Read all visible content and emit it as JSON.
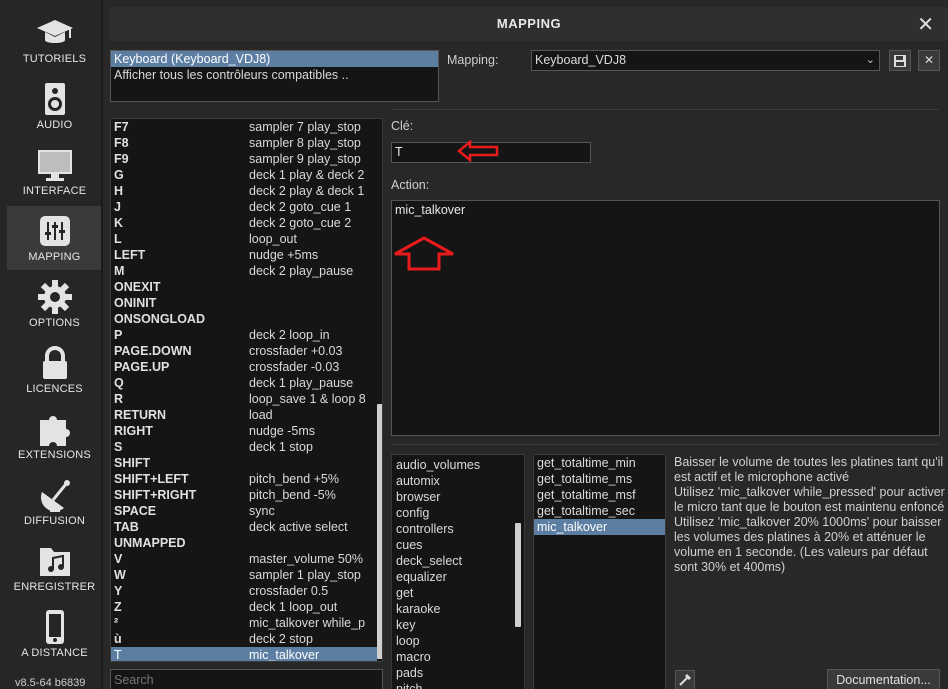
{
  "sidebar": {
    "items": [
      {
        "label": "TUTORIELS",
        "icon": "graduation-cap-icon"
      },
      {
        "label": "AUDIO",
        "icon": "speaker-icon"
      },
      {
        "label": "INTERFACE",
        "icon": "monitor-icon"
      },
      {
        "label": "MAPPING",
        "icon": "mixer-sliders-icon",
        "active": true
      },
      {
        "label": "OPTIONS",
        "icon": "gear-icon"
      },
      {
        "label": "LICENCES",
        "icon": "lock-icon"
      },
      {
        "label": "EXTENSIONS",
        "icon": "puzzle-icon"
      },
      {
        "label": "DIFFUSION",
        "icon": "broadcast-icon"
      },
      {
        "label": "ENREGISTRER",
        "icon": "music-folder-icon"
      },
      {
        "label": "A DISTANCE",
        "icon": "phone-icon"
      }
    ],
    "version": "v8.5-64 b6839"
  },
  "window": {
    "title": "MAPPING",
    "close": "✕"
  },
  "controllers": [
    {
      "label": "Keyboard (Keyboard_VDJ8)",
      "selected": true
    },
    {
      "label": "Afficher tous les contrôleurs compatibles ..",
      "selected": false
    }
  ],
  "mapping": {
    "label": "Mapping:",
    "value": "Keyboard_VDJ8",
    "save_icon": "save-icon",
    "delete_icon": "delete-icon"
  },
  "keys": [
    {
      "key": "F7",
      "action": "sampler  7 play_stop"
    },
    {
      "key": "F8",
      "action": "sampler  8 play_stop"
    },
    {
      "key": "F9",
      "action": "sampler  9 play_stop"
    },
    {
      "key": "G",
      "action": "deck 1 play & deck 2"
    },
    {
      "key": "H",
      "action": "deck 2 play & deck 1"
    },
    {
      "key": "J",
      "action": "deck 2 goto_cue 1"
    },
    {
      "key": "K",
      "action": "deck 2 goto_cue 2"
    },
    {
      "key": "L",
      "action": "loop_out"
    },
    {
      "key": "LEFT",
      "action": "nudge +5ms"
    },
    {
      "key": "M",
      "action": "deck 2 play_pause"
    },
    {
      "key": "ONEXIT",
      "action": ""
    },
    {
      "key": "ONINIT",
      "action": ""
    },
    {
      "key": "ONSONGLOAD",
      "action": ""
    },
    {
      "key": "P",
      "action": "deck 2 loop_in"
    },
    {
      "key": "PAGE.DOWN",
      "action": "crossfader +0.03"
    },
    {
      "key": "PAGE.UP",
      "action": "crossfader -0.03"
    },
    {
      "key": "Q",
      "action": "deck 1 play_pause"
    },
    {
      "key": "R",
      "action": "loop_save 1 & loop 8"
    },
    {
      "key": "RETURN",
      "action": "load"
    },
    {
      "key": "RIGHT",
      "action": "nudge -5ms"
    },
    {
      "key": "S",
      "action": "deck 1 stop"
    },
    {
      "key": "SHIFT",
      "action": ""
    },
    {
      "key": "SHIFT+LEFT",
      "action": "pitch_bend +5%"
    },
    {
      "key": "SHIFT+RIGHT",
      "action": "pitch_bend -5%"
    },
    {
      "key": "SPACE",
      "action": "sync"
    },
    {
      "key": "TAB",
      "action": "deck active select"
    },
    {
      "key": "UNMAPPED",
      "action": ""
    },
    {
      "key": "V",
      "action": "master_volume 50%"
    },
    {
      "key": "W",
      "action": "sampler 1 play_stop"
    },
    {
      "key": "Y",
      "action": "crossfader 0.5"
    },
    {
      "key": "Z",
      "action": "deck 1 loop_out"
    },
    {
      "key": "²",
      "action": "mic_talkover  while_p"
    },
    {
      "key": "ù",
      "action": "deck 2 stop"
    },
    {
      "key": "T",
      "action": "mic_talkover",
      "selected": true
    }
  ],
  "search": {
    "placeholder": "Search"
  },
  "editor": {
    "key_label": "Clé:",
    "key_value": "T",
    "action_label": "Action:",
    "action_value": "mic_talkover"
  },
  "annotations": {
    "color": "#e81b1b"
  },
  "verbs": [
    "audio_volumes",
    "automix",
    "browser",
    "config",
    "controllers",
    "cues",
    "deck_select",
    "equalizer",
    "get",
    "karaoke",
    "key",
    "loop",
    "macro",
    "pads",
    "pitch"
  ],
  "verbs2": [
    {
      "label": "get_totaltime_min"
    },
    {
      "label": "get_totaltime_ms"
    },
    {
      "label": "get_totaltime_msf"
    },
    {
      "label": "get_totaltime_sec"
    },
    {
      "label": "mic_talkover",
      "selected": true
    }
  ],
  "description": "Baisser le volume de toutes les platines tant qu'il est actif et le microphone activé\nUtilisez 'mic_talkover while_pressed' pour activer le micro tant que le bouton est maintenu enfoncé\nUtilisez 'mic_talkover 20% 1000ms' pour baisser les volumes des platines à 20% et atténuer le volume en 1 seconde. (Les valeurs par défaut sont 30% et 400ms)",
  "buttons": {
    "picker_icon": "eyedropper-icon",
    "documentation": "Documentation..."
  },
  "colors": {
    "selection": "#5d7ea3",
    "background": "#282828",
    "sidebar": "#262626"
  }
}
